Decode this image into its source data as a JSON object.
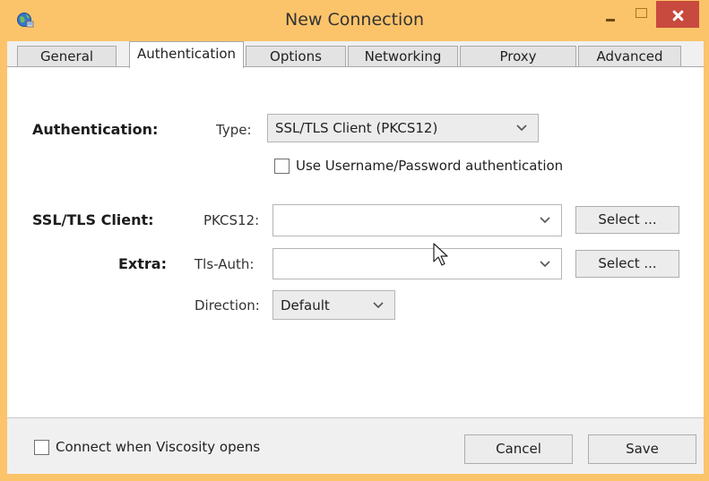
{
  "window": {
    "title": "New Connection",
    "accent_color": "#fcc46a",
    "close_color": "#c84a3e",
    "icon": "globe-network-icon"
  },
  "tabs": [
    {
      "label": "General",
      "active": false
    },
    {
      "label": "Authentication",
      "active": true
    },
    {
      "label": "Options",
      "active": false
    },
    {
      "label": "Networking",
      "active": false
    },
    {
      "label": "Proxy",
      "active": false
    },
    {
      "label": "Advanced",
      "active": false
    }
  ],
  "authentication": {
    "section_label": "Authentication:",
    "type_label": "Type:",
    "type_value": "SSL/TLS Client (PKCS12)",
    "use_username_label": "Use Username/Password authentication",
    "use_username_checked": false
  },
  "ssl_tls_client": {
    "section_label": "SSL/TLS Client:",
    "pkcs12_label": "PKCS12:",
    "pkcs12_value": "",
    "select_label": "Select ..."
  },
  "extra": {
    "section_label": "Extra:",
    "tls_auth_label": "Tls-Auth:",
    "tls_auth_value": "",
    "select_label": "Select ...",
    "direction_label": "Direction:",
    "direction_value": "Default"
  },
  "footer": {
    "connect_on_open_label": "Connect when Viscosity opens",
    "connect_on_open_checked": false,
    "cancel_label": "Cancel",
    "save_label": "Save"
  }
}
